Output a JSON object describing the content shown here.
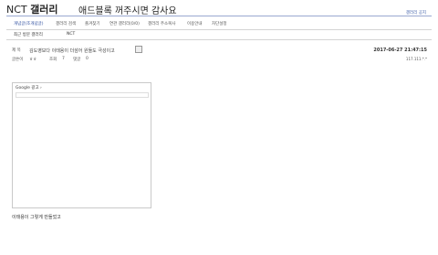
{
  "header": {
    "logo_prefix": "NCT ",
    "logo_gallery": "갤러리",
    "banner": "애드블록 꺼주시면 감사요",
    "top_right_link": "갤러리 공지"
  },
  "menu": {
    "items": [
      {
        "label": "개념글(조개념글)",
        "active": true
      },
      {
        "label": "갤러리 검색",
        "active": false
      },
      {
        "label": "즐겨찾기",
        "active": false
      },
      {
        "label": "연관 갤러리(0/0)",
        "active": false
      },
      {
        "label": "갤러리 주소복사",
        "active": false
      },
      {
        "label": "이용안내",
        "active": false
      },
      {
        "label": "차단설정",
        "active": false
      }
    ]
  },
  "subbar": {
    "recent_label": "최근 방문 갤러리",
    "recent_item": "NCT"
  },
  "post": {
    "title_label": "제 목",
    "title": "김도영보다 이태용이 더섬어 원들도 극성이고",
    "date": "2017-06-27 21:47:15",
    "author_label": "글쓴이",
    "author": "ㅎㅎ",
    "views_label": "조회",
    "views": "7",
    "comments_label": "댓글",
    "comments": "0",
    "ip": "117.111.*.*"
  },
  "ad": {
    "label": "Google 광고 ›"
  },
  "body": {
    "text": "이태용이 그렇게 만들었고"
  }
}
